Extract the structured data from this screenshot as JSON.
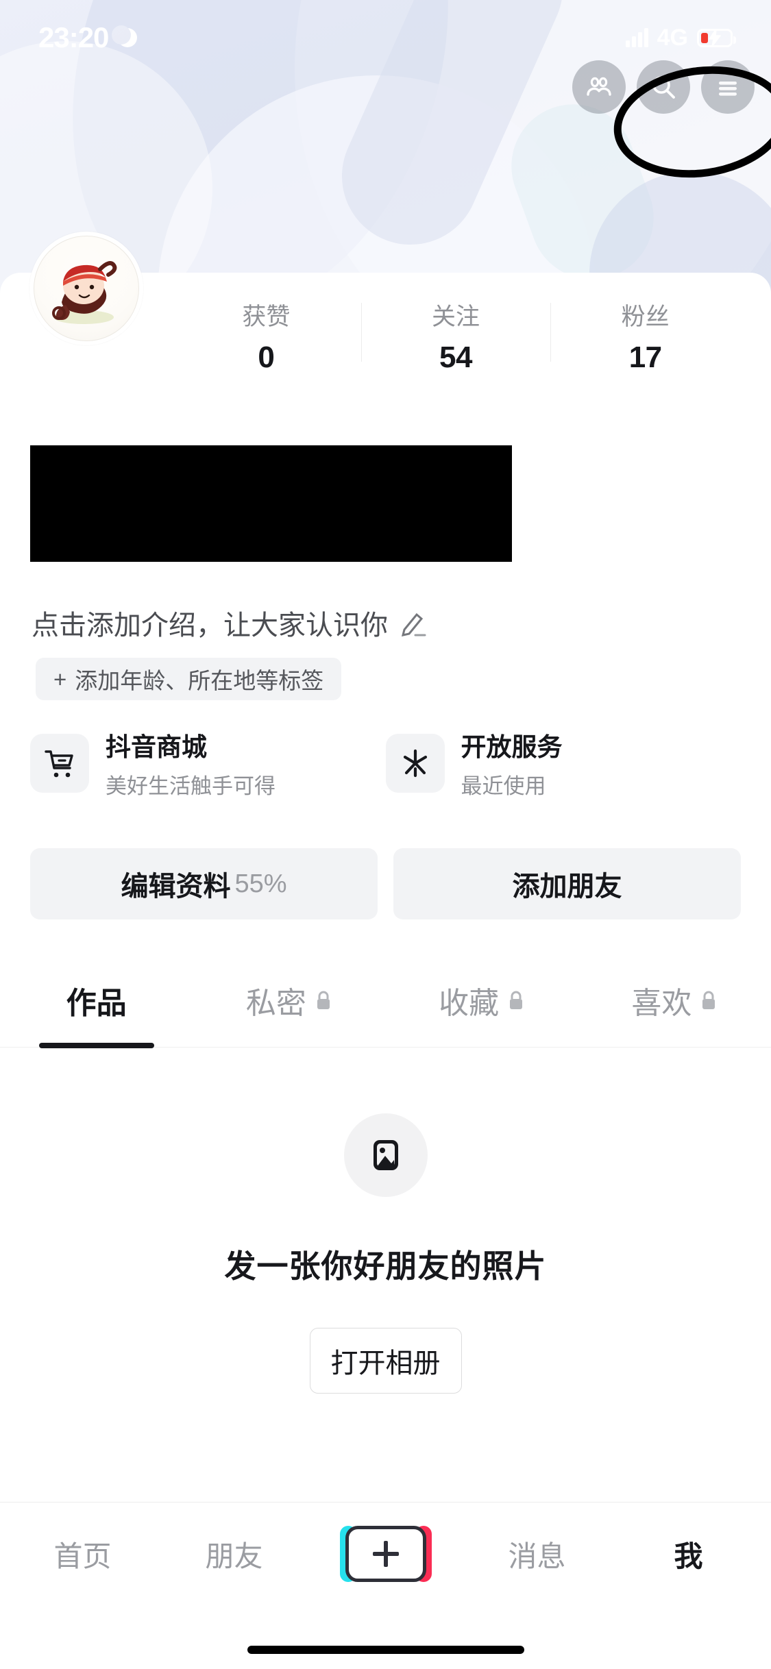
{
  "status_bar": {
    "time": "23:20",
    "dnd_icon": "moon-icon",
    "signal_icon": "signal-bars-icon",
    "network": "4G",
    "battery_icon": "battery-low-charging-icon",
    "battery_level_percent": 26
  },
  "header": {
    "actions": [
      {
        "name": "friends-icon",
        "label": ""
      },
      {
        "name": "search-icon",
        "label": ""
      },
      {
        "name": "menu-icon",
        "label": ""
      }
    ],
    "annotation": "hand-drawn-circle-around-menu"
  },
  "profile": {
    "avatar_alt": "cartoon character avatar",
    "name_redacted": true,
    "stats": [
      {
        "label": "获赞",
        "value": "0"
      },
      {
        "label": "关注",
        "value": "54"
      },
      {
        "label": "粉丝",
        "value": "17"
      }
    ],
    "bio_placeholder": "点击添加介绍，让大家认识你",
    "bio_edit_icon": "pencil-icon",
    "tag_chip": "添加年龄、所在地等标签",
    "tag_chip_plus": "+"
  },
  "services": [
    {
      "icon": "shopping-cart-icon",
      "title": "抖音商城",
      "subtitle": "美好生活触手可得"
    },
    {
      "icon": "asterisk-icon",
      "title": "开放服务",
      "subtitle": "最近使用"
    }
  ],
  "actions": {
    "edit_profile_label": "编辑资料",
    "edit_profile_percent": "55%",
    "add_friend_label": "添加朋友"
  },
  "tabs": [
    {
      "label": "作品",
      "locked": false,
      "active": true
    },
    {
      "label": "私密",
      "locked": true,
      "active": false
    },
    {
      "label": "收藏",
      "locked": true,
      "active": false
    },
    {
      "label": "喜欢",
      "locked": true,
      "active": false
    }
  ],
  "empty_state": {
    "icon": "image-placeholder-icon",
    "message": "发一张你好朋友的照片",
    "button_label": "打开相册"
  },
  "bottom_nav": {
    "items": [
      {
        "label": "首页",
        "active": false
      },
      {
        "label": "朋友",
        "active": false
      },
      {
        "label": "+",
        "active": false,
        "is_create": true
      },
      {
        "label": "消息",
        "active": false
      },
      {
        "label": "我",
        "active": true
      }
    ]
  },
  "colors": {
    "accent_cyan": "#26e0ec",
    "accent_pink": "#fa2d54",
    "text_primary": "#16171b",
    "text_secondary": "#9a9ca1",
    "chip_bg": "#f2f3f5",
    "battery_low": "#f13a2f"
  }
}
